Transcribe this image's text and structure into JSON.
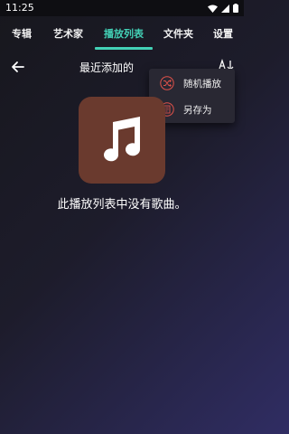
{
  "status_bar": {
    "time": "11:25",
    "icons": [
      "wifi-icon",
      "signal-icon",
      "battery-icon"
    ]
  },
  "tabs": [
    {
      "label": "专辑",
      "active": false
    },
    {
      "label": "艺术家",
      "active": false
    },
    {
      "label": "播放列表",
      "active": true
    },
    {
      "label": "文件夹",
      "active": false
    },
    {
      "label": "设置",
      "active": false
    }
  ],
  "toolbar": {
    "title": "最近添加的",
    "back_icon": "arrow-left-icon",
    "more_icon": "more-icon",
    "sort_icon": "sort-icon"
  },
  "menu": {
    "items": [
      {
        "label": "随机播放",
        "icon": "shuffle-icon"
      },
      {
        "label": "另存为",
        "icon": "save-playlist-icon"
      }
    ]
  },
  "empty_state": {
    "message": "此播放列表中没有歌曲。",
    "icon": "music-note-icon"
  },
  "colors": {
    "accent": "#43d1b6",
    "art_background": "#6a3a2e",
    "menu_icon": "#e0524a",
    "menu_background": "#292833"
  }
}
